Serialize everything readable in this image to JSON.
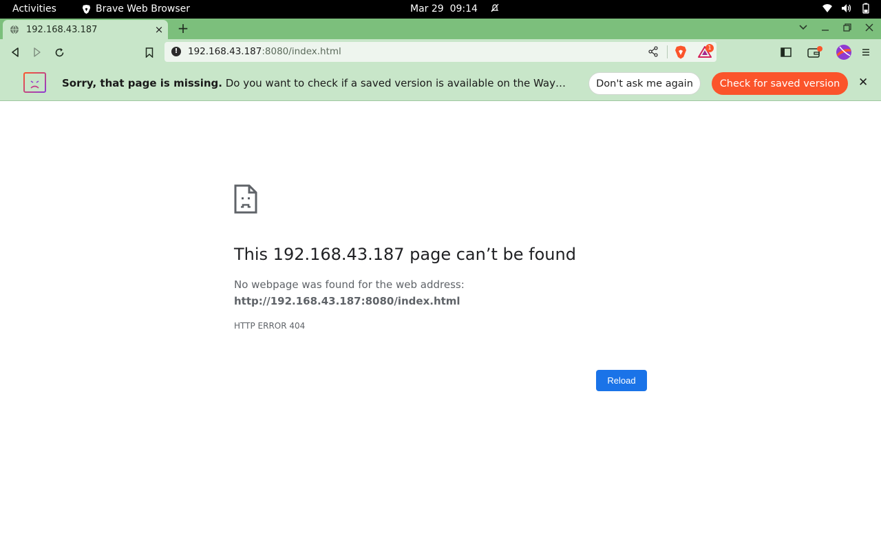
{
  "topbar": {
    "activities": "Activities",
    "app_name": "Brave Web Browser",
    "date": "Mar 29",
    "time": "09:14"
  },
  "tab": {
    "title": "192.168.43.187",
    "close": "×"
  },
  "newtab": "+",
  "omnibox": {
    "host": "192.168.43.187",
    "rest": ":8080/index.html",
    "rewards_badge": "1"
  },
  "infobar": {
    "bold": "Sorry, that page is missing.",
    "message": " Do you want to check if a saved version is available on the Wayback Machine?",
    "dismiss_label": "Don't ask me again",
    "check_label": "Check for saved version",
    "close": "✕"
  },
  "error": {
    "title": "This 192.168.43.187 page can’t be found",
    "description": "No webpage was found for the web address:",
    "url": "http://192.168.43.187:8080/index.html",
    "code": "HTTP ERROR 404",
    "reload_label": "Reload"
  },
  "colors": {
    "chrome_green": "#c8e6c9",
    "tabstrip_green": "#7cbf7c",
    "brave_orange": "#fb542b",
    "reload_blue": "#1a73e8"
  },
  "icons": [
    "brave-lion-icon",
    "bell-muted-icon",
    "wifi-icon",
    "volume-icon",
    "battery-icon",
    "globe-icon",
    "close-icon",
    "plus-icon",
    "chevron-down-icon",
    "minimize-icon",
    "restore-icon",
    "back-icon",
    "forward-icon",
    "reload-icon",
    "bookmark-icon",
    "info-icon",
    "share-icon",
    "brave-shields-icon",
    "brave-rewards-icon",
    "sidebar-icon",
    "wallet-icon",
    "profile-avatar-icon",
    "menu-icon",
    "sad-page-icon",
    "sad-document-icon"
  ]
}
